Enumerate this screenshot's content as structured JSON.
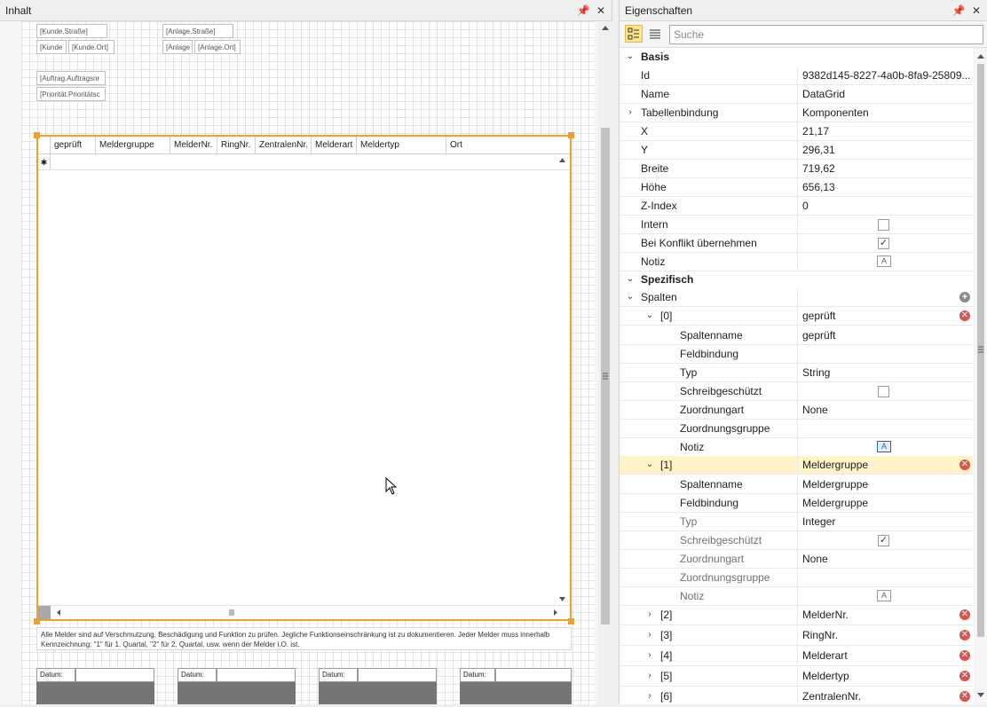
{
  "left_panel": {
    "title": "Inhalt",
    "fields": {
      "kunde_strasse": "[Kunde.Straße]",
      "kunde_name": "[Kunde",
      "kunde_ort": "[Kunde.Ort]",
      "anlage_strasse": "[Anlage.Straße]",
      "anlage_name": "[Anlage",
      "anlage_ort": "[Anlage.Ort]",
      "auftrag": "[Auftrag.Auftragsnr",
      "prioritaet": "[Priorität.Prioritätsc"
    },
    "grid": {
      "columns": [
        "geprüft",
        "Meldergruppe",
        "MelderNr.",
        "RingNr.",
        "ZentralenNr.",
        "Melderart",
        "Meldertyp",
        "Ort"
      ],
      "new_row_marker": "✱"
    },
    "note": "Alle Melder sind auf Verschmutzung, Beschädigung und Funktion zu prüfen. Jegliche Funktionseinschränkung ist zu dokumentieren. Jeder Melder muss innerhalb Kennzeichnung: \"1\" für 1. Quartal, \"2\" für 2. Quartal, usw. wenn der Melder i.O. ist.",
    "date_label": "Datum:"
  },
  "right_panel": {
    "title": "Eigenschaften",
    "search_placeholder": "Suche",
    "basis": {
      "header": "Basis",
      "id_label": "Id",
      "id_value": "9382d145-8227-4a0b-8fa9-25809...",
      "name_label": "Name",
      "name_value": "DataGrid",
      "binding_label": "Tabellenbindung",
      "binding_value": "Komponenten",
      "x_label": "X",
      "x_value": "21,17",
      "y_label": "Y",
      "y_value": "296,31",
      "width_label": "Breite",
      "width_value": "719,62",
      "height_label": "Höhe",
      "height_value": "656,13",
      "zindex_label": "Z-Index",
      "zindex_value": "0",
      "intern_label": "Intern",
      "conflict_label": "Bei Konflikt übernehmen",
      "note_label": "Notiz"
    },
    "specific": {
      "header": "Spezifisch",
      "columns_label": "Spalten",
      "col0": {
        "index": "[0]",
        "value": "geprüft",
        "spaltenname_label": "Spaltenname",
        "spaltenname": "geprüft",
        "feldbindung_label": "Feldbindung",
        "feldbindung": "",
        "typ_label": "Typ",
        "typ": "String",
        "schreib_label": "Schreibgeschützt",
        "zuord_label": "Zuordnungart",
        "zuord": "None",
        "zgruppe_label": "Zuordnungsgruppe",
        "zgruppe": "",
        "notiz_label": "Notiz"
      },
      "col1": {
        "index": "[1]",
        "value": "Meldergruppe",
        "spaltenname_label": "Spaltenname",
        "spaltenname": "Meldergruppe",
        "feldbindung_label": "Feldbindung",
        "feldbindung": "Meldergruppe",
        "typ_label": "Typ",
        "typ": "Integer",
        "schreib_label": "Schreibgeschützt",
        "zuord_label": "Zuordnungart",
        "zuord": "None",
        "zgruppe_label": "Zuordnungsgruppe",
        "zgruppe": "",
        "notiz_label": "Notiz"
      },
      "others": [
        {
          "index": "[2]",
          "value": "MelderNr."
        },
        {
          "index": "[3]",
          "value": "RingNr."
        },
        {
          "index": "[4]",
          "value": "Melderart"
        },
        {
          "index": "[5]",
          "value": "Meldertyp"
        },
        {
          "index": "[6]",
          "value": "ZentralenNr."
        }
      ]
    }
  }
}
